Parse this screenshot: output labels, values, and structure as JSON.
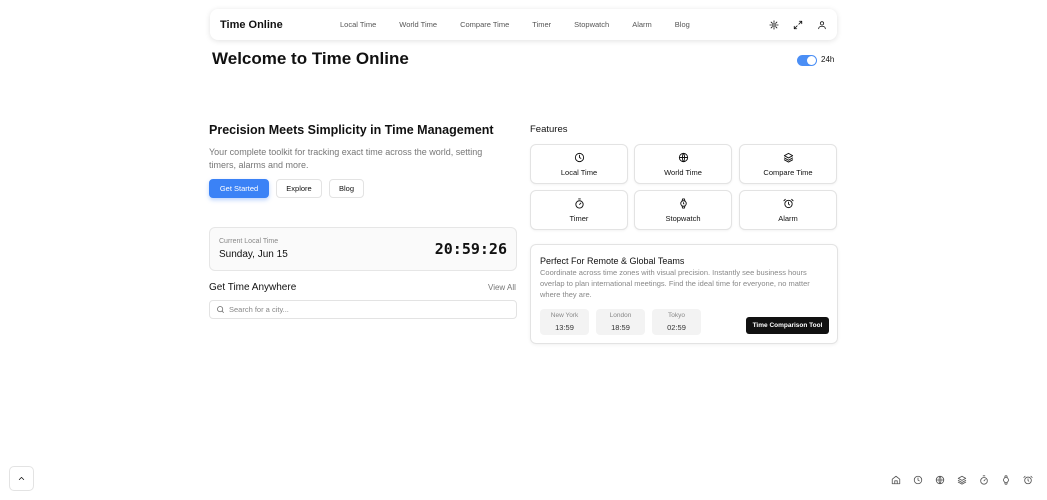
{
  "nav": {
    "brand": "Time Online",
    "links": [
      "Local Time",
      "World Time",
      "Compare Time",
      "Timer",
      "Stopwatch",
      "Alarm",
      "Blog"
    ]
  },
  "header": {
    "title": "Welcome to Time Online",
    "toggle_label": "24h",
    "toggle_on": true
  },
  "hero": {
    "title": "Precision Meets Simplicity in Time Management",
    "description": "Your complete toolkit for tracking exact time across the world, setting timers, alarms and more.",
    "buttons": [
      "Get Started",
      "Explore",
      "Blog"
    ]
  },
  "clock": {
    "label": "Current Local Time",
    "date": "Sunday, Jun 15",
    "time": "20:59:26"
  },
  "anywhere": {
    "title": "Get Time Anywhere",
    "view_all": "View All",
    "placeholder": "Search for a city..."
  },
  "features": {
    "title": "Features",
    "items": [
      "Local Time",
      "World Time",
      "Compare Time",
      "Timer",
      "Stopwatch",
      "Alarm"
    ]
  },
  "teams": {
    "title": "Perfect For Remote & Global Teams",
    "description": "Coordinate across time zones with visual precision. Instantly see business hours overlap to plan international meetings. Find the ideal time for everyone, no matter where they are.",
    "cities": [
      {
        "name": "New York",
        "time": "13:59"
      },
      {
        "name": "London",
        "time": "18:59"
      },
      {
        "name": "Tokyo",
        "time": "02:59"
      }
    ],
    "button": "Time Comparison Tool"
  },
  "colors": {
    "accent": "#3b82f6",
    "dark": "#111111"
  }
}
